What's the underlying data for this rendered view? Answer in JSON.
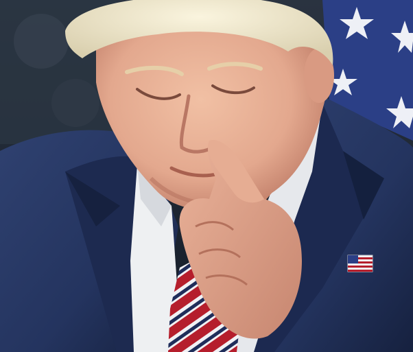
{
  "photo": {
    "subjects": [
      "person-in-suit",
      "flag-lapel-pin",
      "striped-tie",
      "hand-on-face",
      "star-background"
    ],
    "colors": {
      "suit": "#24345f",
      "suit_shadow": "#141d38",
      "shirt": "#eef0f2",
      "tie_red": "#b51e2c",
      "tie_navy": "#1f2d5a",
      "skin": "#e3a88e",
      "skin_shadow": "#b87460",
      "hair": "#e9e2c9",
      "flag_blue": "#2b3f86",
      "background_dark": "#1e2a3d"
    }
  }
}
